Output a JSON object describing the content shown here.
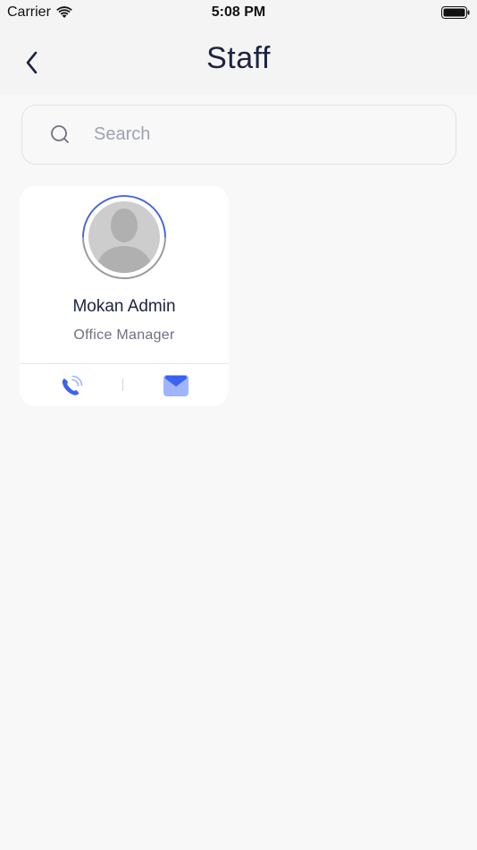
{
  "status_bar": {
    "carrier": "Carrier",
    "time": "5:08 PM"
  },
  "header": {
    "title": "Staff",
    "back_icon": "chevron-left-icon"
  },
  "search": {
    "placeholder": "Search",
    "value": "",
    "icon": "search-icon"
  },
  "staff": [
    {
      "name": "Mokan Admin",
      "role": "Office Manager",
      "call_icon": "phone-icon",
      "email_icon": "mail-icon"
    }
  ],
  "colors": {
    "accent": "#3b63f0",
    "accent_light": "#9fb4fb",
    "title": "#1c2340",
    "muted": "#6e7180",
    "background": "#f8f8f8"
  }
}
